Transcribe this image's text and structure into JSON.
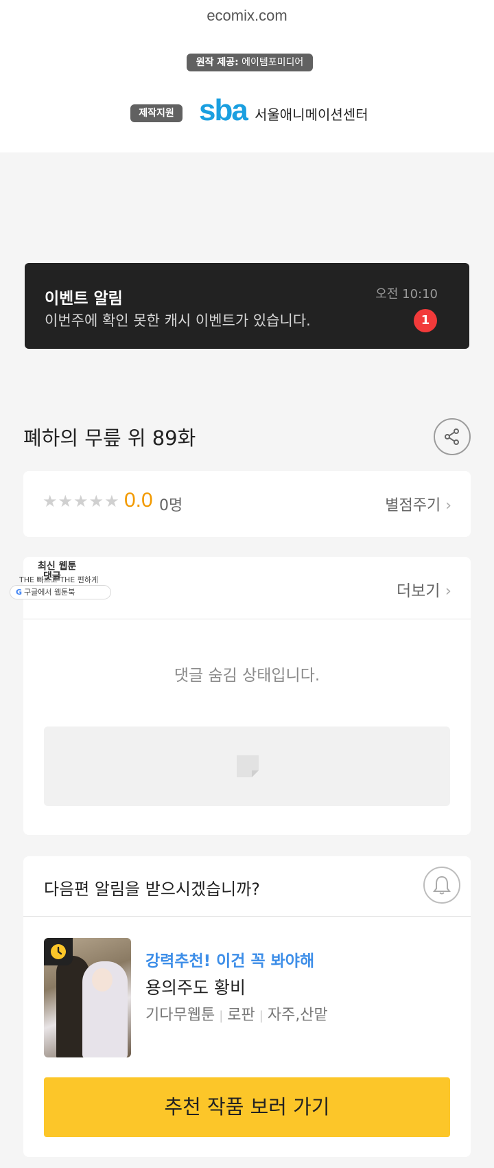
{
  "header": {
    "site": "ecomix.com",
    "original_provider_label": "원작 제공:",
    "original_provider_name": "에이템포미디어",
    "production_label": "제작지원",
    "sba_logo": "sba",
    "sba_name": "서울애니메이션센터"
  },
  "notice": {
    "title": "이벤트 알림",
    "body": "이번주에 확인 못한 캐시 이벤트가 있습니다.",
    "time": "오전 10:10",
    "badge": "1",
    "colors": {
      "background": "#222222",
      "badge": "#f23a3a"
    }
  },
  "episode": {
    "title": "폐하의 무릎 위 89화",
    "share_icon": "share-icon"
  },
  "rating": {
    "stars": "★★★★★",
    "score": "0.0",
    "count": "0명",
    "rate_link": "별점주기",
    "score_color": "#f29a00"
  },
  "comments": {
    "header_title": "댓글",
    "more_link": "더보기",
    "hidden_message": "댓글 숨김 상태입니다."
  },
  "ad": {
    "line1": "최신 웹툰",
    "line2": "THE 빠르고 THE 편하게",
    "pill_text": "구글에서 웹툰북"
  },
  "next": {
    "question": "다음편 알림을 받으시겠습니까?",
    "bell_icon": "bell-icon",
    "recommend_tag": "강력추천! 이건 꼭 봐야해",
    "recommend_title": "용의주도 황비",
    "meta": [
      "기다무웹툰",
      "로판",
      "자주,산맡"
    ],
    "button": "추천 작품 보러 가기",
    "accent_color": "#fcc629",
    "tag_color": "#3d8ee8"
  }
}
